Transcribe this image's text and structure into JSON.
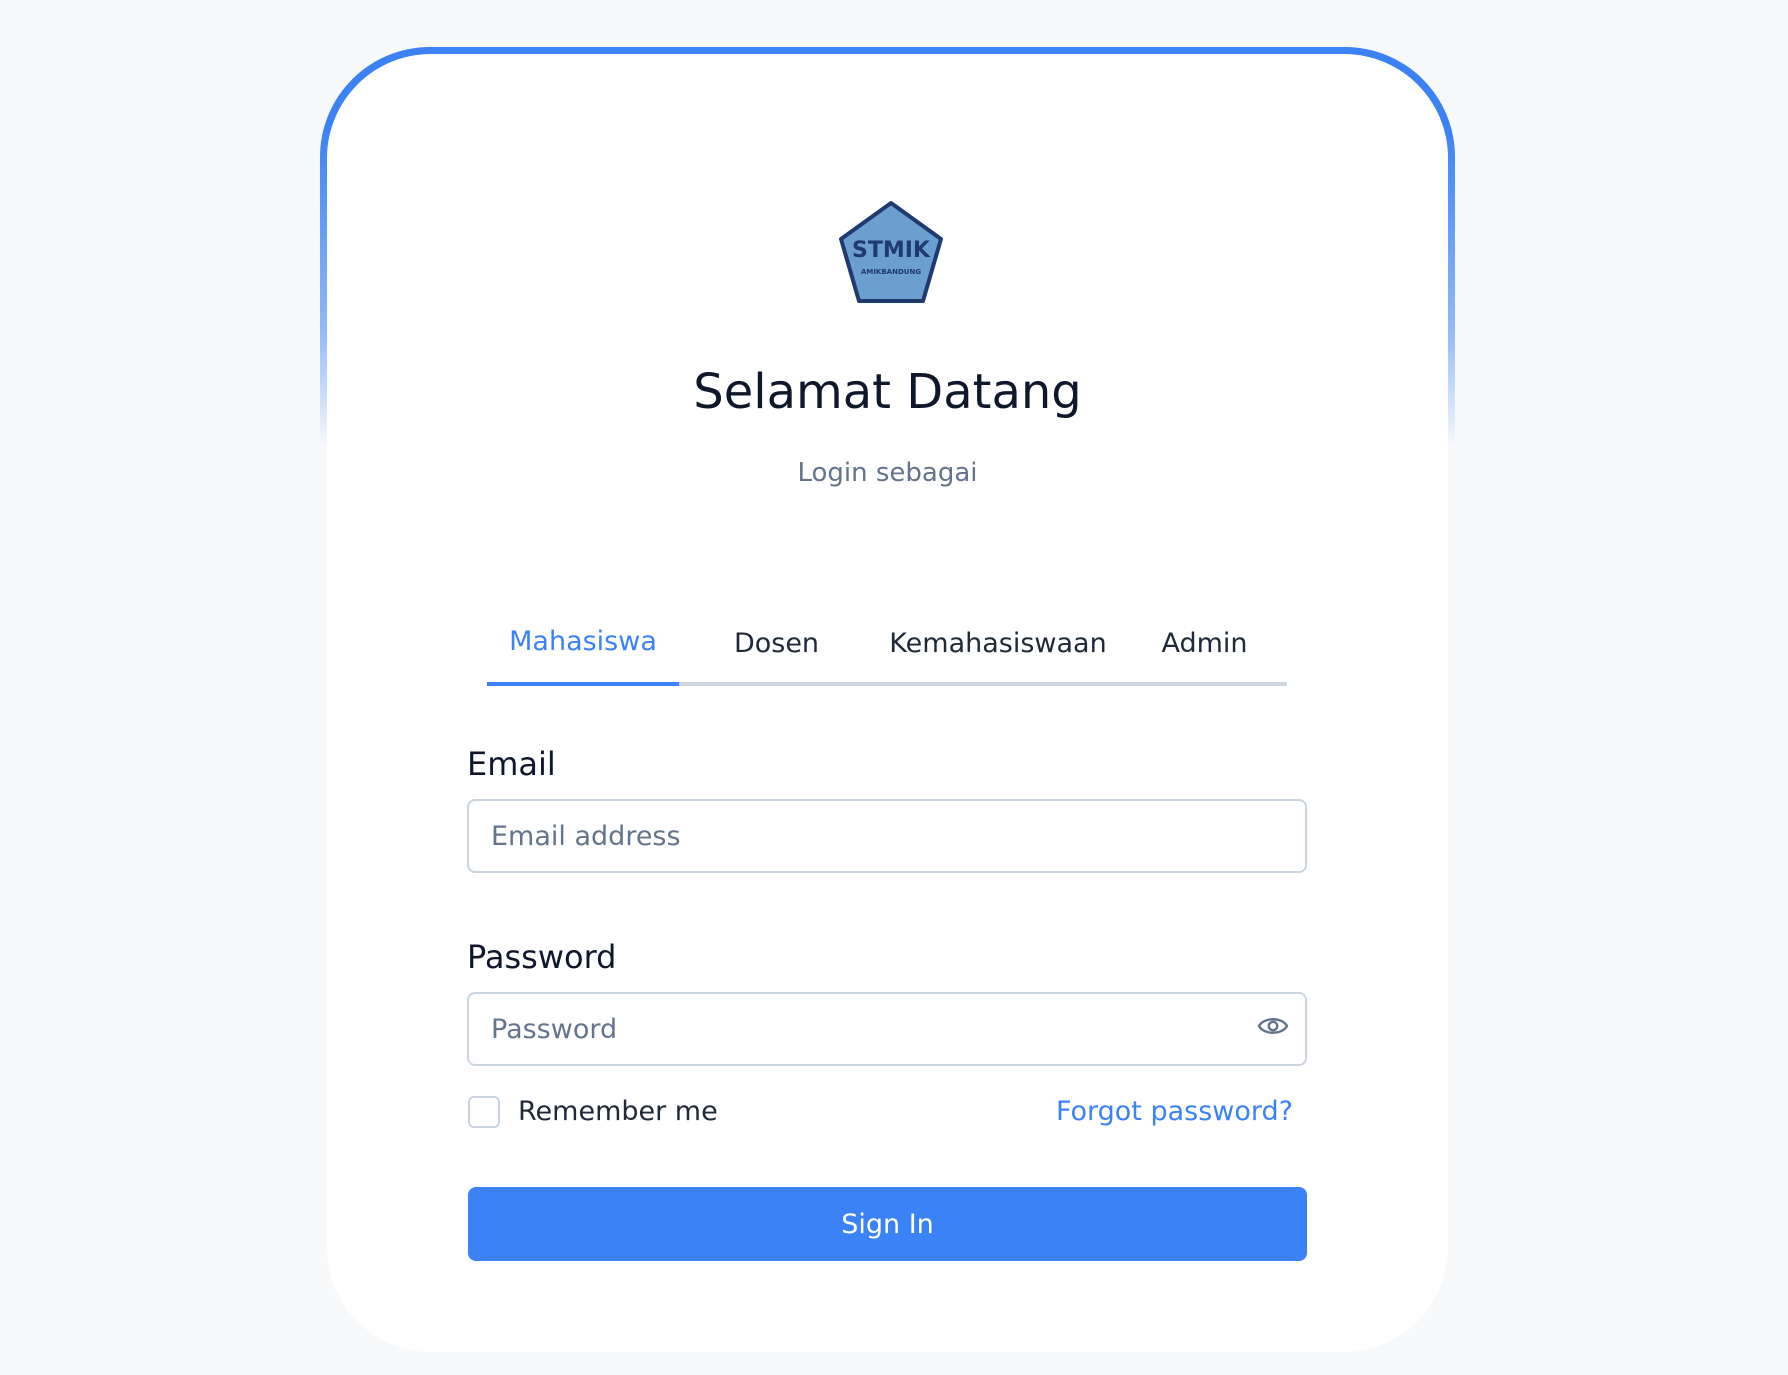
{
  "logo": {
    "text": "STMIK",
    "subtext": "AMIKBANDUNG"
  },
  "header": {
    "title": "Selamat Datang",
    "subtitle": "Login sebagai"
  },
  "tabs": [
    {
      "label": "Mahasiswa",
      "active": true
    },
    {
      "label": "Dosen",
      "active": false
    },
    {
      "label": "Kemahasiswaan",
      "active": false
    },
    {
      "label": "Admin",
      "active": false
    }
  ],
  "form": {
    "email_label": "Email",
    "email_placeholder": "Email address",
    "email_value": "",
    "password_label": "Password",
    "password_placeholder": "Password",
    "password_value": "",
    "remember_label": "Remember me",
    "remember_checked": false,
    "forgot_label": "Forgot password?",
    "submit_label": "Sign In"
  },
  "icons": {
    "password_toggle": "eye-icon"
  },
  "colors": {
    "accent": "#3b82f6",
    "title": "#0f172a",
    "muted": "#64748b",
    "logo_fill": "#6b9fcf",
    "logo_stroke": "#1e3a6e"
  }
}
